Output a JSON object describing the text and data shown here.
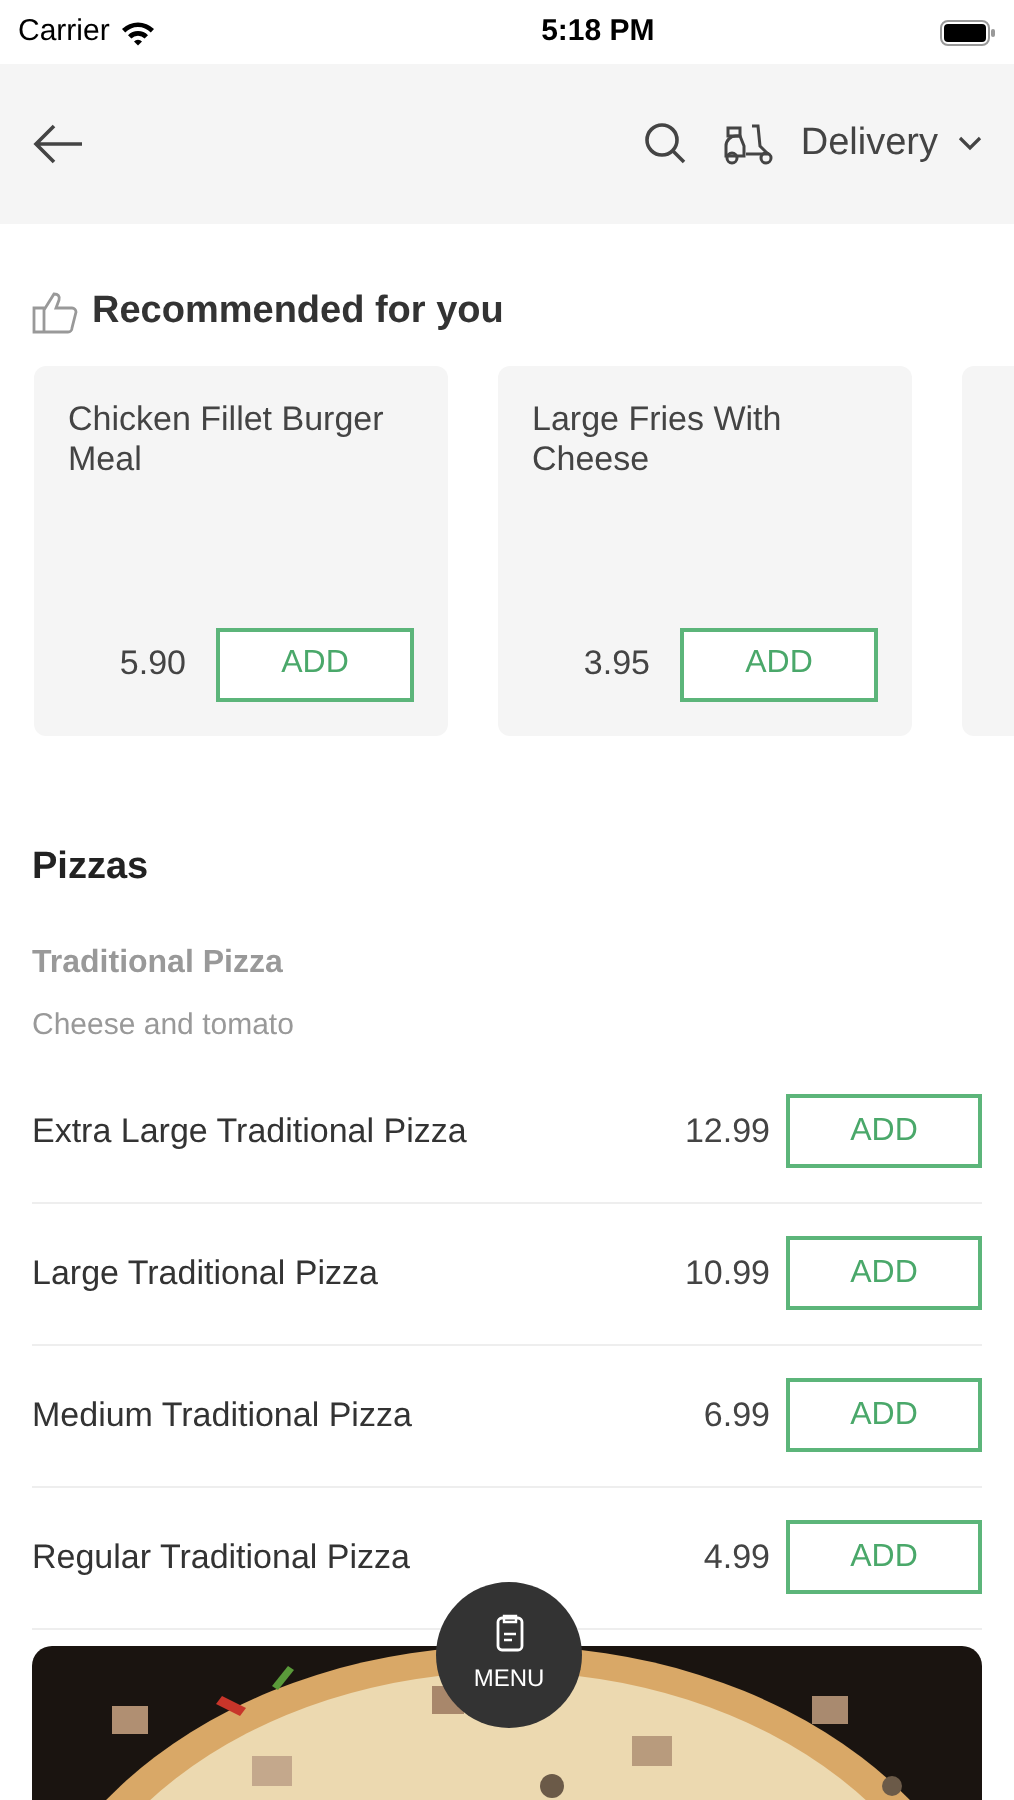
{
  "status_bar": {
    "carrier": "Carrier",
    "time": "5:18 PM"
  },
  "header": {
    "mode": "Delivery"
  },
  "recommended": {
    "title": "Recommended for you",
    "items": [
      {
        "name": "Chicken Fillet Burger Meal",
        "price": "5.90",
        "button": "ADD"
      },
      {
        "name": "Large Fries With Cheese",
        "price": "3.95",
        "button": "ADD"
      }
    ]
  },
  "section": {
    "title": "Pizzas",
    "group": "Traditional Pizza",
    "description": "Cheese and tomato",
    "items": [
      {
        "name": "Extra Large Traditional Pizza",
        "price": "12.99",
        "button": "ADD"
      },
      {
        "name": "Large Traditional Pizza",
        "price": "10.99",
        "button": "ADD"
      },
      {
        "name": "Medium Traditional Pizza",
        "price": "6.99",
        "button": "ADD"
      },
      {
        "name": "Regular Traditional Pizza",
        "price": "4.99",
        "button": "ADD"
      }
    ]
  },
  "menu_button": {
    "label": "MENU"
  }
}
